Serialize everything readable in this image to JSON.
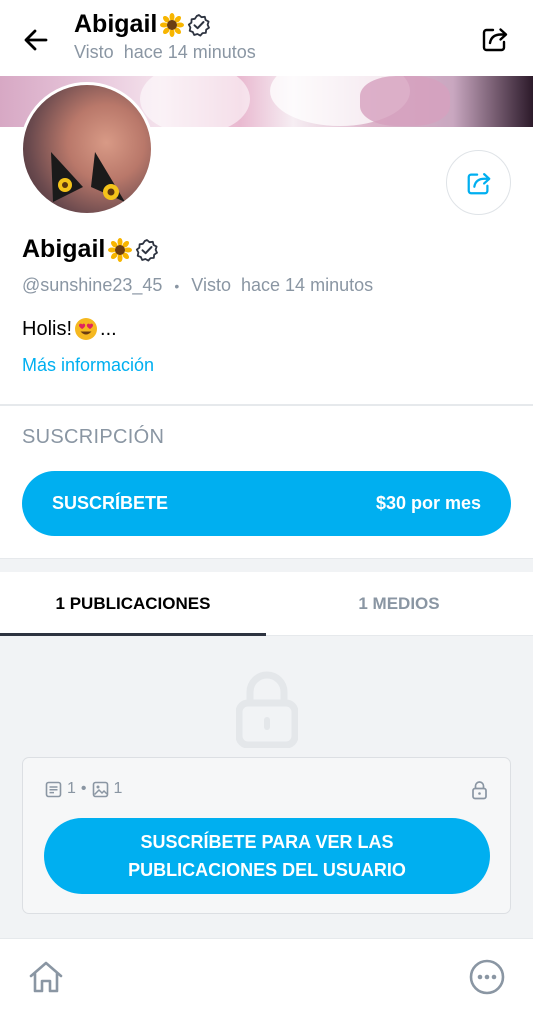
{
  "header": {
    "name": "Abigail",
    "last_seen_label": "Visto",
    "last_seen_time": "hace 14 minutos"
  },
  "profile": {
    "name": "Abigail",
    "handle": "@sunshine23_45",
    "separator": "•",
    "last_seen_label": "Visto",
    "last_seen_time": "hace 14 minutos",
    "bio_text": "Holis!",
    "bio_ellipsis": "...",
    "more_info": "Más información"
  },
  "subscription": {
    "title": "SUSCRIPCIÓN",
    "button_label": "SUSCRÍBETE",
    "price": "$30 por mes"
  },
  "tabs": [
    {
      "label": "1 PUBLICACIONES",
      "active": true
    },
    {
      "label": "1 MEDIOS",
      "active": false
    }
  ],
  "locked": {
    "posts_count": "1",
    "dot": "•",
    "media_count": "1",
    "button_label": "SUSCRÍBETE PARA VER LAS PUBLICACIONES DEL USUARIO"
  },
  "icons": {
    "back": "arrow-left-icon",
    "share": "share-icon",
    "verified": "verified-badge-icon",
    "sunflower": "sunflower-emoji",
    "heart_eyes": "heart-eyes-emoji",
    "lock": "lock-icon",
    "post": "post-icon",
    "image": "image-icon",
    "home": "home-icon",
    "more": "more-dots-icon"
  },
  "colors": {
    "accent": "#00aff0",
    "muted": "#8a96a3",
    "text": "#000000",
    "background_alt": "#f1f3f5"
  }
}
